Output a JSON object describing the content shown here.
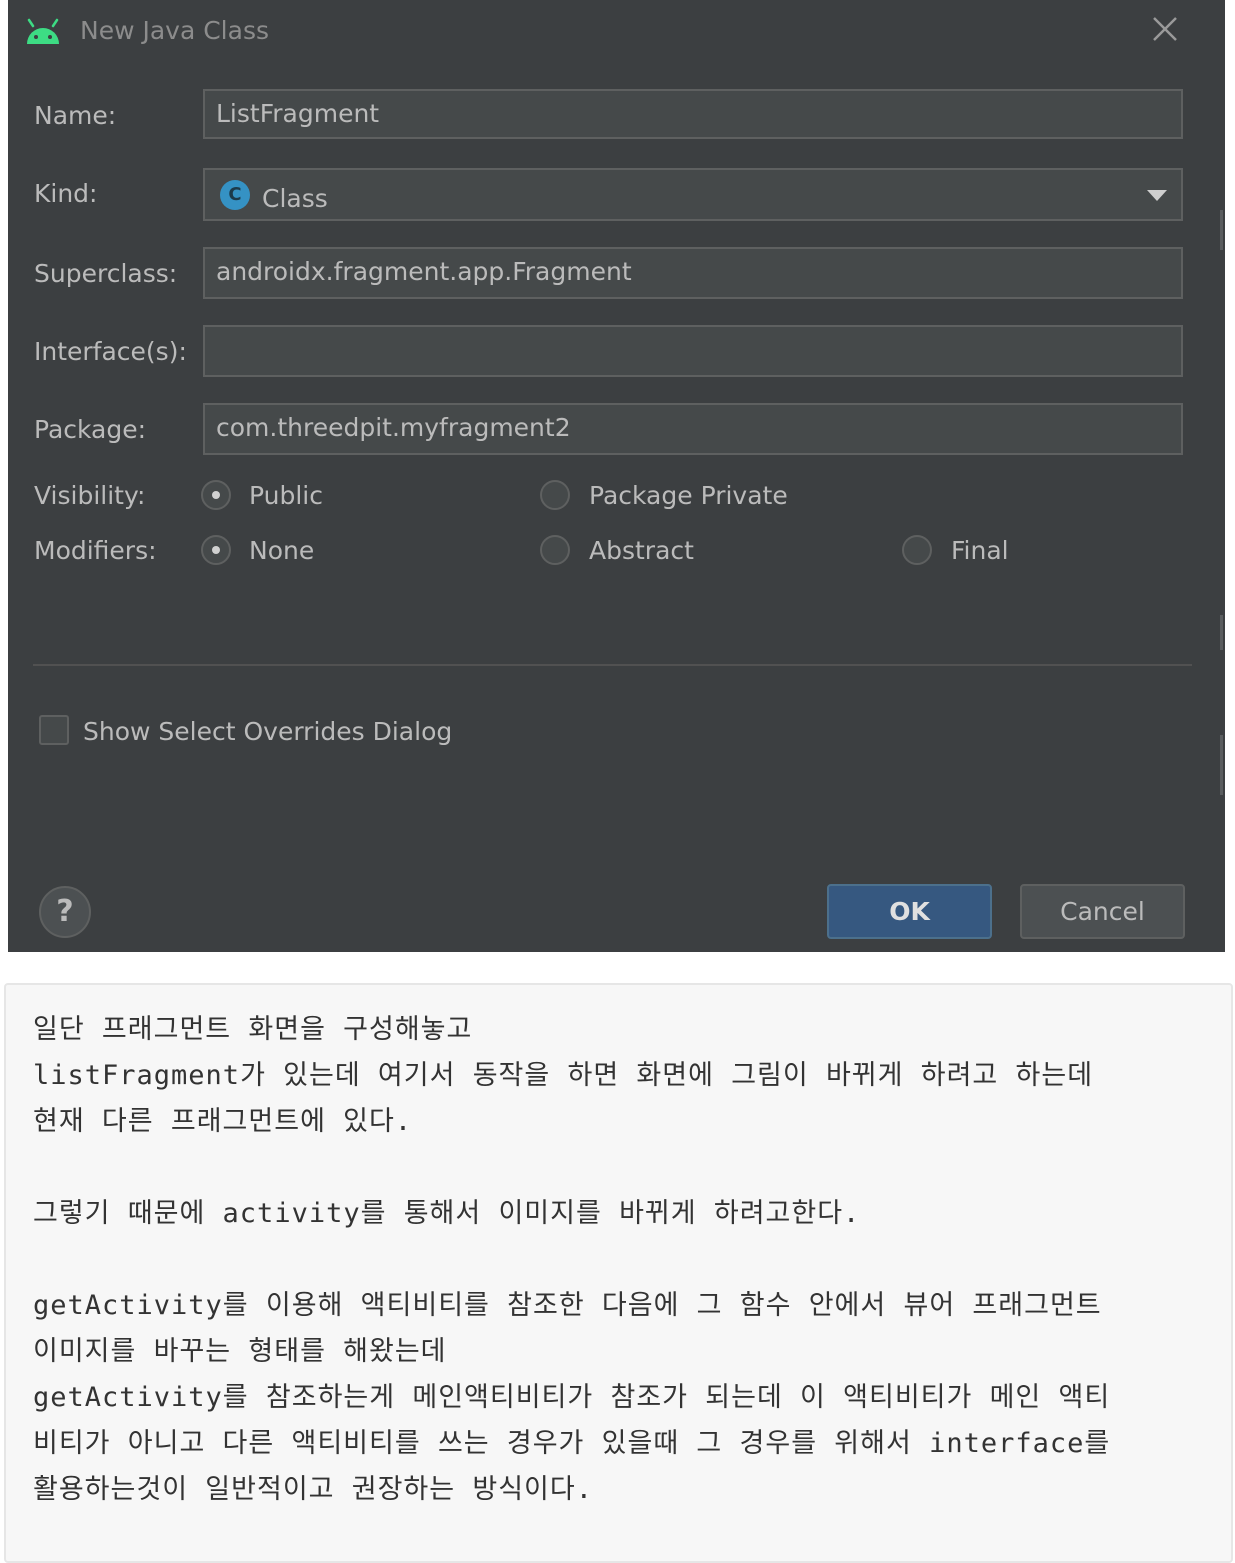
{
  "dialog": {
    "title": "New Java Class",
    "close_icon": "close-icon",
    "fields": {
      "name_label": "Name:",
      "name_value": "ListFragment",
      "kind_label": "Kind:",
      "kind_value": "Class",
      "kind_icon_letter": "C",
      "superclass_label": "Superclass:",
      "superclass_value": "androidx.fragment.app.Fragment",
      "interfaces_label": "Interface(s):",
      "interfaces_value": "",
      "package_label": "Package:",
      "package_value": "com.threedpit.myfragment2"
    },
    "visibility": {
      "label": "Visibility:",
      "options": [
        "Public",
        "Package Private"
      ],
      "selected": "Public"
    },
    "modifiers": {
      "label": "Modifiers:",
      "options": [
        "None",
        "Abstract",
        "Final"
      ],
      "selected": "None"
    },
    "show_overrides_label": "Show Select Overrides Dialog",
    "show_overrides_checked": false,
    "help_label": "?",
    "ok_label": "OK",
    "cancel_label": "Cancel",
    "colors": {
      "background": "#3c3f41",
      "ok_button": "#365880",
      "android_icon": "#3ddc84"
    }
  },
  "note": {
    "lines": [
      "일단 프래그먼트 화면을 구성해놓고",
      "listFragment가 있는데 여기서 동작을 하면 화면에 그림이 바뀌게 하려고 하는데",
      "현재 다른 프래그먼트에 있다.",
      "",
      "그렇기 때문에 activity를 통해서 이미지를 바뀌게 하려고한다.",
      "",
      "getActivity를 이용해 액티비티를 참조한 다음에 그 함수 안에서 뷰어 프래그먼트",
      "이미지를 바꾸는 형태를 해왔는데",
      "getActivity를 참조하는게 메인액티비티가 참조가 되는데 이 액티비티가 메인 액티",
      "비티가 아니고 다른 액티비티를 쓰는 경우가 있을때 그 경우를 위해서 interface를",
      "활용하는것이 일반적이고 권장하는 방식이다."
    ]
  }
}
